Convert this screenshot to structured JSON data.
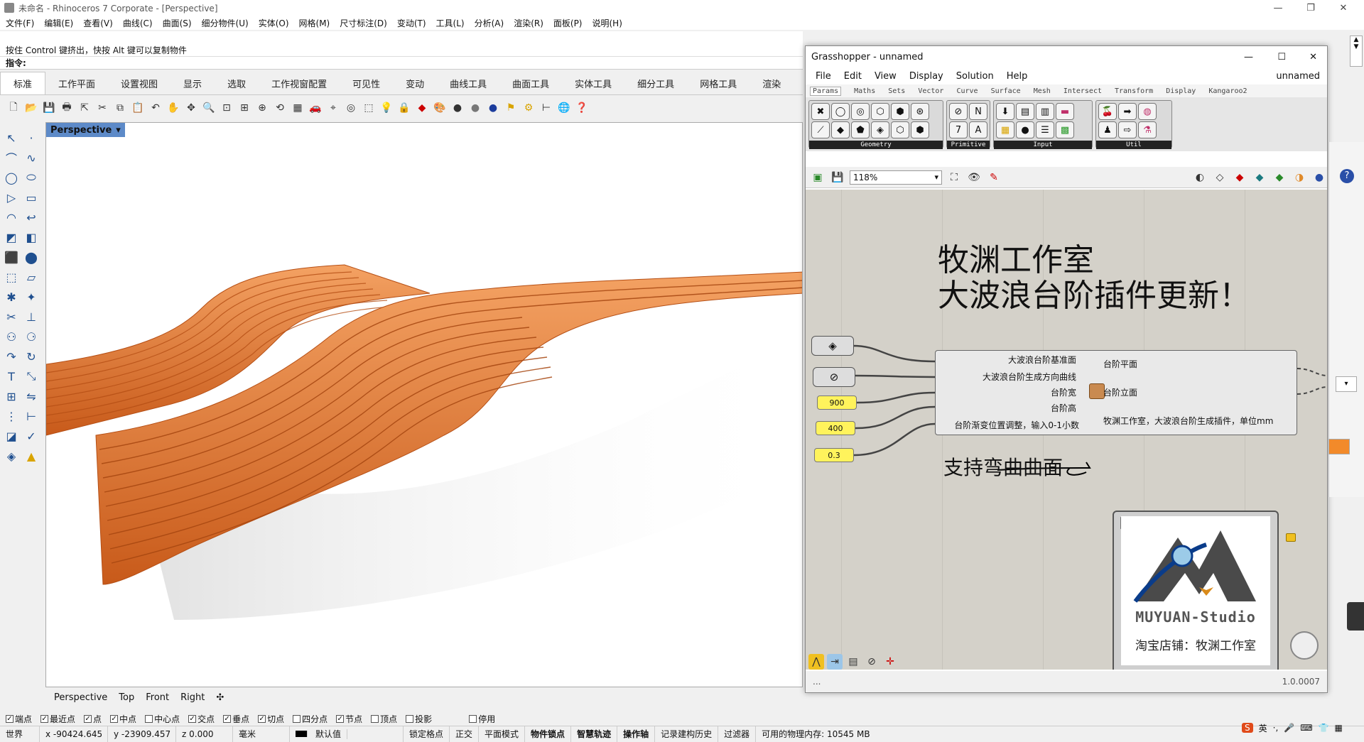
{
  "app": {
    "title": "未命名 - Rhinoceros 7 Corporate - [Perspective]"
  },
  "menu": [
    "文件(F)",
    "编辑(E)",
    "查看(V)",
    "曲线(C)",
    "曲面(S)",
    "细分物件(U)",
    "实体(O)",
    "网格(M)",
    "尺寸标注(D)",
    "变动(T)",
    "工具(L)",
    "分析(A)",
    "渲染(R)",
    "面板(P)",
    "说明(H)"
  ],
  "command": {
    "history_line": "按住 Control 键挤出，快按 Alt 键可以复制物件",
    "prompt": "指令:"
  },
  "toolbar_tabs": [
    "标准",
    "工作平面",
    "设置视图",
    "显示",
    "选取",
    "工作视窗配置",
    "可见性",
    "变动",
    "曲线工具",
    "曲面工具",
    "实体工具",
    "细分工具",
    "网格工具",
    "渲染"
  ],
  "viewport": {
    "label": "Perspective",
    "tabs": [
      "Perspective",
      "Top",
      "Front",
      "Right"
    ],
    "object_color": "#e8792d"
  },
  "osnaps": [
    {
      "label": "端点",
      "checked": true
    },
    {
      "label": "最近点",
      "checked": true
    },
    {
      "label": "点",
      "checked": true
    },
    {
      "label": "中点",
      "checked": true
    },
    {
      "label": "中心点",
      "checked": false
    },
    {
      "label": "交点",
      "checked": true
    },
    {
      "label": "垂点",
      "checked": true
    },
    {
      "label": "切点",
      "checked": true
    },
    {
      "label": "四分点",
      "checked": false
    },
    {
      "label": "节点",
      "checked": true
    },
    {
      "label": "顶点",
      "checked": false
    },
    {
      "label": "投影",
      "checked": false
    },
    {
      "label": "停用",
      "checked": false
    }
  ],
  "status": {
    "cplane": "世界",
    "x": "x -90424.645",
    "y": "y -23909.457",
    "z": "z 0.000",
    "units": "毫米",
    "layer": "默认值",
    "items": [
      "锁定格点",
      "正交",
      "平面模式",
      "物件锁点",
      "智慧轨迹",
      "操作轴",
      "记录建构历史",
      "过滤器"
    ],
    "memory": "可用的物理内存: 10545 MB"
  },
  "grasshopper": {
    "title": "Grasshopper - unnamed",
    "menu": [
      "File",
      "Edit",
      "View",
      "Display",
      "Solution",
      "Help"
    ],
    "doc_name": "unnamed",
    "tabs": [
      "Params",
      "Maths",
      "Sets",
      "Vector",
      "Curve",
      "Surface",
      "Mesh",
      "Intersect",
      "Transform",
      "Display",
      "Kangaroo2"
    ],
    "groups": [
      "Geometry",
      "Primitive",
      "Input",
      "Util"
    ],
    "zoom": "118%",
    "heading_line1": "牧渊工作室",
    "heading_line2": "大波浪台阶插件更新！",
    "component": {
      "inputs": [
        "大波浪台阶基准面",
        "大波浪台阶生成方向曲线",
        "台阶宽",
        "台阶高",
        "台阶渐变位置调整，输入0-1小数"
      ],
      "outputs": [
        "台阶平面",
        "台阶立面",
        "牧渊工作室，大波浪台阶生成插件，单位mm"
      ]
    },
    "sliders": [
      "900",
      "400",
      "0.3"
    ],
    "note": "支持弯曲曲面",
    "logo_text": "MUYUAN-Studio",
    "shop_text": "淘宝店铺：牧渊工作室",
    "version": "1.0.0007",
    "status_left": "..."
  }
}
